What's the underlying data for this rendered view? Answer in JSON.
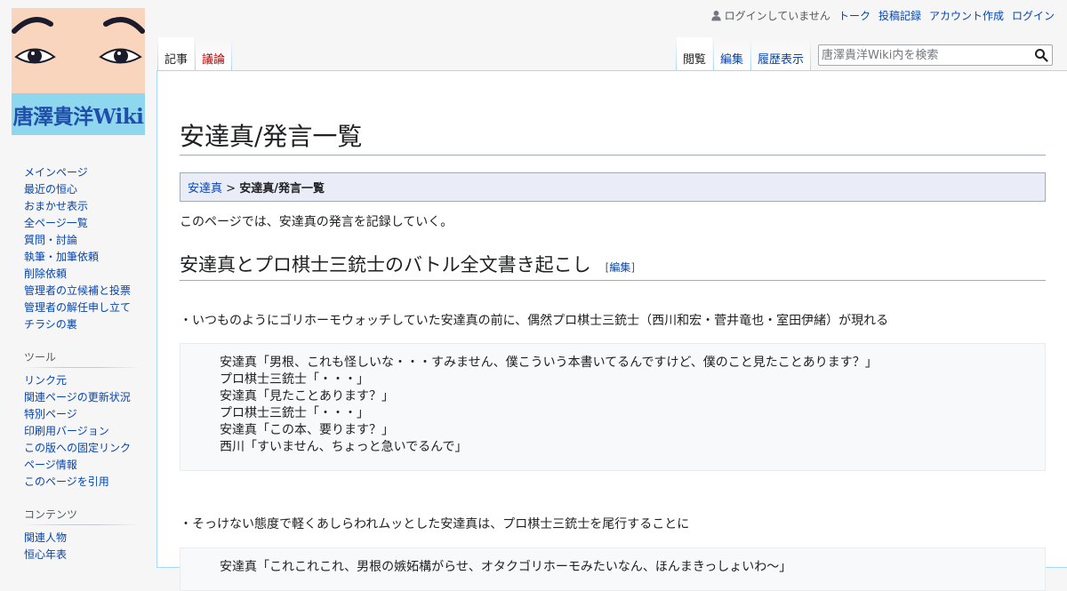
{
  "logo": {
    "wordmark": "唐澤貴洋Wiki"
  },
  "personal": {
    "anon_text": "ログインしていません",
    "links": [
      "トーク",
      "投稿記録",
      "アカウント作成",
      "ログイン"
    ]
  },
  "tabs": {
    "article": "記事",
    "talk": "議論",
    "view": "閲覧",
    "edit": "編集",
    "history": "履歴表示"
  },
  "search": {
    "placeholder": "唐澤貴洋Wiki内を検索"
  },
  "sidebar": {
    "navigation": [
      "メインページ",
      "最近の恒心",
      "おまかせ表示",
      "全ページ一覧",
      "質問・討論",
      "執筆・加筆依頼",
      "削除依頼",
      "管理者の立候補と投票",
      "管理者の解任申し立て",
      "チラシの裏"
    ],
    "tools_heading": "ツール",
    "tools": [
      "リンク元",
      "関連ページの更新状況",
      "特別ページ",
      "印刷用バージョン",
      "この版への固定リンク",
      "ページ情報",
      "このページを引用"
    ],
    "contents_heading": "コンテンツ",
    "contents": [
      "関連人物",
      "恒心年表"
    ]
  },
  "page": {
    "title": "安達真/発言一覧",
    "breadcrumb_link": "安達真",
    "breadcrumb_sep": ">",
    "breadcrumb_current": "安達真/発言一覧",
    "intro": "このページでは、安達真の発言を記録していく。",
    "section_heading": "安達真とプロ棋士三銃士のバトル全文書き起こし",
    "edit_link": "編集",
    "para1": "・いつものようにゴリホーモウォッチしていた安達真の前に、偶然プロ棋士三銃士（西川和宏・菅井竜也・室田伊緒）が現れる",
    "dialogue1": [
      "安達真「男根、これも怪しいな・・・すみません、僕こういう本書いてるんですけど、僕のこと見たことあります？」",
      "プロ棋士三銃士「・・・」",
      "安達真「見たことあります？」",
      "プロ棋士三銃士「・・・」",
      "安達真「この本、要ります？」",
      "西川「すいません、ちょっと急いでるんで」"
    ],
    "para2": "・そっけない態度で軽くあしらわれムッとした安達真は、プロ棋士三銃士を尾行することに",
    "dialogue2": [
      "安達真「これこれこれ、男根の嫉妬構がらせ、オタクゴリホーモみたいなん、ほんまきっしょいわ～」"
    ]
  }
}
